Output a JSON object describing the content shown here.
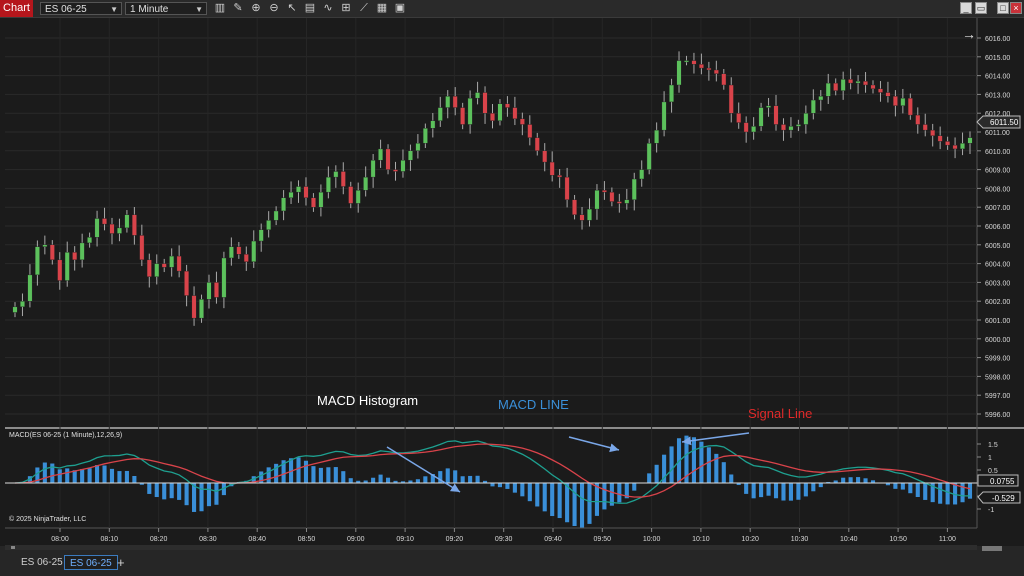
{
  "titlebar": {
    "chart_label": "Chart",
    "instrument": "ES 06-25",
    "interval": "1 Minute"
  },
  "annotations": {
    "histogram": "MACD Histogram",
    "macd_line": "MACD LINE",
    "signal_line": "Signal Line"
  },
  "indicator_label": "MACD(ES 06-25 (1 Minute),12,26,9)",
  "copyright": "© 2025 NinjaTrader, LLC",
  "price_axis": {
    "ticks": [
      "6016.00",
      "6015.00",
      "6014.00",
      "6013.00",
      "6012.00",
      "6011.00",
      "6010.00",
      "6009.00",
      "6008.00",
      "6007.00",
      "6006.00",
      "6005.00",
      "6004.00",
      "6003.00",
      "6002.00",
      "6001.00",
      "6000.00",
      "5999.00",
      "5998.00",
      "5997.00",
      "5996.00"
    ],
    "last_price": "6011.50"
  },
  "macd_axis": {
    "ticks": [
      "1.5",
      "1",
      "0.5",
      "0",
      "-0.5",
      "-1"
    ],
    "value_badge": "0.0755",
    "signal_badge": "-0.529"
  },
  "time_axis": [
    "08:00",
    "08:10",
    "08:20",
    "08:30",
    "08:40",
    "08:50",
    "09:00",
    "09:10",
    "09:20",
    "09:30",
    "09:40",
    "09:50",
    "10:00",
    "10:10",
    "10:20",
    "10:30",
    "10:40",
    "10:50",
    "11:00"
  ],
  "tabs": [
    "ES 06-25",
    "ES 06-25"
  ],
  "colors": {
    "up": "#5cc15c",
    "down": "#d9434a",
    "macd": "#1ea090",
    "signal": "#d9434a",
    "histogram": "#3a8fd8",
    "annotation_blue": "#3a8fd8",
    "annotation_red": "#e02a2a"
  },
  "chart_data": {
    "type": "candlestick",
    "price_ylim": [
      5996,
      6016
    ],
    "closes": [
      6001.7,
      6002.0,
      6003.4,
      6004.9,
      6005.0,
      6004.2,
      6003.1,
      6004.6,
      6004.2,
      6005.1,
      6005.4,
      6006.4,
      6006.1,
      6005.6,
      6005.9,
      6006.6,
      6005.5,
      6004.2,
      6003.3,
      6004.0,
      6003.8,
      6004.4,
      6003.6,
      6002.3,
      6001.1,
      6002.1,
      6003.0,
      6002.2,
      6004.3,
      6004.9,
      6004.5,
      6004.1,
      6005.2,
      6005.8,
      6006.3,
      6006.8,
      6007.5,
      6007.8,
      6008.1,
      6007.5,
      6007.0,
      6007.8,
      6008.6,
      6008.9,
      6008.1,
      6007.2,
      6007.9,
      6008.6,
      6009.5,
      6010.1,
      6009.0,
      6008.9,
      6009.5,
      6010.0,
      6010.4,
      6011.2,
      6011.6,
      6012.3,
      6012.9,
      6012.3,
      6011.4,
      6012.8,
      6013.1,
      6012.0,
      6011.6,
      6012.5,
      6012.3,
      6011.7,
      6011.4,
      6010.7,
      6010.0,
      6009.4,
      6008.7,
      6008.6,
      6007.4,
      6006.6,
      6006.3,
      6006.9,
      6007.9,
      6007.8,
      6007.3,
      6007.2,
      6007.4,
      6008.5,
      6009.0,
      6010.4,
      6011.1,
      6012.6,
      6013.5,
      6014.8,
      6014.8,
      6014.6,
      6014.4,
      6014.3,
      6014.1,
      6013.5,
      6012.0,
      6011.5,
      6011.0,
      6011.3,
      6012.3,
      6012.4,
      6011.4,
      6011.1,
      6011.3,
      6011.4,
      6012.0,
      6012.7,
      6012.9,
      6013.6,
      6013.2,
      6013.8,
      6013.6,
      6013.7,
      6013.5,
      6013.3,
      6013.1,
      6012.9,
      6012.4,
      6012.8,
      6011.9,
      6011.4,
      6011.1,
      6010.8,
      6010.5,
      6010.3,
      6010.1,
      6010.4,
      6010.7
    ],
    "macd_ylim": [
      -1.5,
      2.0
    ],
    "macd_ticks": [
      1.5,
      1,
      0.5,
      0,
      -0.5,
      -1
    ],
    "macd_last": 0.0755,
    "signal_last": -0.529
  }
}
